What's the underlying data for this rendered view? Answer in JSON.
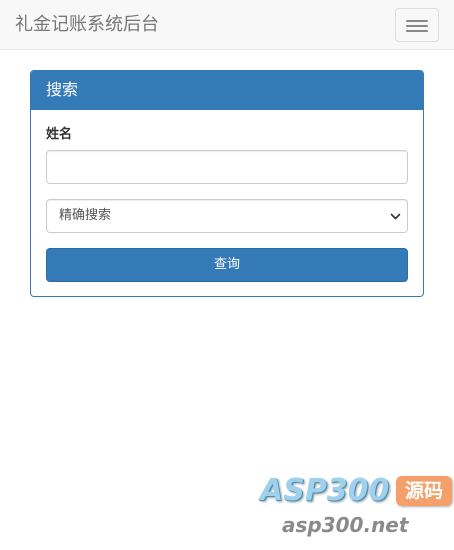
{
  "navbar": {
    "brand": "礼金记账系统后台",
    "toggle_icon": "hamburger-menu-icon"
  },
  "search_panel": {
    "title": "搜索",
    "name_label": "姓名",
    "name_value": "",
    "name_placeholder": "",
    "match_select": {
      "selected": "精确搜索",
      "icon": "chevron-down-icon"
    },
    "query_button": "查询"
  },
  "watermark": {
    "logo_text": "ASP300",
    "logo_badge": "源码",
    "domain": "asp300.net"
  },
  "colors": {
    "primary": "#337ab7",
    "navbar_bg": "#f8f8f8",
    "brand_text": "#777777",
    "watermark_blue": "#9fd0ec",
    "watermark_orange": "#f3a06a"
  }
}
